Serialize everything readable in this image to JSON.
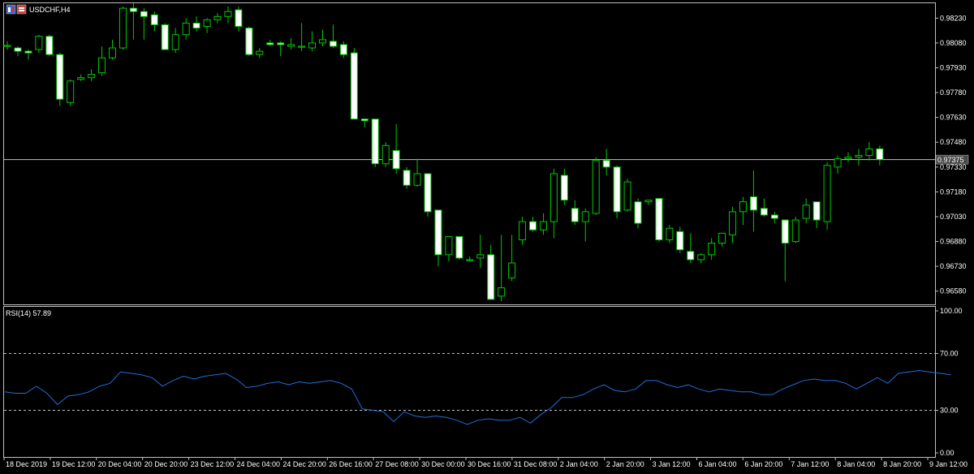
{
  "window": {
    "symbol_title": "USDCHF,H4"
  },
  "chart_data": [
    {
      "type": "candlestick",
      "title": "USDCHF,H4",
      "ylim": [
        0.965,
        0.9832
      ],
      "y_ticks": [
        "0.98230",
        "0.98080",
        "0.97930",
        "0.97780",
        "0.97630",
        "0.97480",
        "0.97330",
        "0.97180",
        "0.97030",
        "0.96880",
        "0.96730",
        "0.96580"
      ],
      "current_price_label": "0.97375",
      "current_price": 0.97375,
      "bull_color": "#00c800",
      "bear_color": "#ffffff",
      "x_labels": [
        "18 Dec 2019",
        "19 Dec 12:00",
        "20 Dec 04:00",
        "20 Dec 20:00",
        "23 Dec 12:00",
        "24 Dec 04:00",
        "24 Dec 20:00",
        "26 Dec 16:00",
        "27 Dec 08:00",
        "30 Dec 00:00",
        "30 Dec 16:00",
        "31 Dec 08:00",
        "2 Jan 04:00",
        "2 Jan 20:00",
        "3 Jan 12:00",
        "6 Jan 04:00",
        "6 Jan 20:00",
        "7 Jan 12:00",
        "8 Jan 04:00",
        "8 Jan 20:00",
        "9 Jan 12:00"
      ],
      "candles": [
        {
          "o": 0.9806,
          "h": 0.9809,
          "l": 0.9804,
          "c": 0.98065
        },
        {
          "o": 0.9805,
          "h": 0.9806,
          "l": 0.98,
          "c": 0.9803
        },
        {
          "o": 0.9803,
          "h": 0.9804,
          "l": 0.9798,
          "c": 0.9802
        },
        {
          "o": 0.9804,
          "h": 0.9813,
          "l": 0.9802,
          "c": 0.9812
        },
        {
          "o": 0.9812,
          "h": 0.9813,
          "l": 0.98,
          "c": 0.9801
        },
        {
          "o": 0.9801,
          "h": 0.9802,
          "l": 0.977,
          "c": 0.9774
        },
        {
          "o": 0.9772,
          "h": 0.9786,
          "l": 0.977,
          "c": 0.9785
        },
        {
          "o": 0.9786,
          "h": 0.9789,
          "l": 0.9785,
          "c": 0.9787
        },
        {
          "o": 0.9787,
          "h": 0.9792,
          "l": 0.9785,
          "c": 0.9789
        },
        {
          "o": 0.979,
          "h": 0.9806,
          "l": 0.9788,
          "c": 0.9799
        },
        {
          "o": 0.9799,
          "h": 0.981,
          "l": 0.9798,
          "c": 0.9805
        },
        {
          "o": 0.9805,
          "h": 0.983,
          "l": 0.9804,
          "c": 0.9829
        },
        {
          "o": 0.9829,
          "h": 0.9832,
          "l": 0.981,
          "c": 0.9827
        },
        {
          "o": 0.9827,
          "h": 0.9829,
          "l": 0.981,
          "c": 0.9824
        },
        {
          "o": 0.9825,
          "h": 0.9827,
          "l": 0.9815,
          "c": 0.9819
        },
        {
          "o": 0.9819,
          "h": 0.982,
          "l": 0.9804,
          "c": 0.9804
        },
        {
          "o": 0.9804,
          "h": 0.9817,
          "l": 0.9802,
          "c": 0.9813
        },
        {
          "o": 0.9813,
          "h": 0.9823,
          "l": 0.981,
          "c": 0.982
        },
        {
          "o": 0.982,
          "h": 0.9824,
          "l": 0.9815,
          "c": 0.9817
        },
        {
          "o": 0.9818,
          "h": 0.9823,
          "l": 0.9814,
          "c": 0.9822
        },
        {
          "o": 0.9822,
          "h": 0.9826,
          "l": 0.982,
          "c": 0.9824
        },
        {
          "o": 0.9824,
          "h": 0.983,
          "l": 0.982,
          "c": 0.9827
        },
        {
          "o": 0.9828,
          "h": 0.983,
          "l": 0.9815,
          "c": 0.9818
        },
        {
          "o": 0.9817,
          "h": 0.9818,
          "l": 0.98,
          "c": 0.9801
        },
        {
          "o": 0.9801,
          "h": 0.9805,
          "l": 0.9799,
          "c": 0.9803
        },
        {
          "o": 0.9808,
          "h": 0.981,
          "l": 0.9806,
          "c": 0.9807
        },
        {
          "o": 0.9808,
          "h": 0.9809,
          "l": 0.98,
          "c": 0.9807
        },
        {
          "o": 0.9806,
          "h": 0.9811,
          "l": 0.9804,
          "c": 0.9807
        },
        {
          "o": 0.9806,
          "h": 0.982,
          "l": 0.9803,
          "c": 0.9806
        },
        {
          "o": 0.9805,
          "h": 0.9815,
          "l": 0.9803,
          "c": 0.9808
        },
        {
          "o": 0.9808,
          "h": 0.9816,
          "l": 0.9806,
          "c": 0.981
        },
        {
          "o": 0.9809,
          "h": 0.9819,
          "l": 0.9805,
          "c": 0.9806
        },
        {
          "o": 0.9807,
          "h": 0.9809,
          "l": 0.9799,
          "c": 0.9801
        },
        {
          "o": 0.9802,
          "h": 0.9805,
          "l": 0.9762,
          "c": 0.9762
        },
        {
          "o": 0.9762,
          "h": 0.9762,
          "l": 0.9757,
          "c": 0.9761
        },
        {
          "o": 0.9762,
          "h": 0.9762,
          "l": 0.9733,
          "c": 0.9735
        },
        {
          "o": 0.9735,
          "h": 0.9748,
          "l": 0.9733,
          "c": 0.9746
        },
        {
          "o": 0.9743,
          "h": 0.9759,
          "l": 0.9729,
          "c": 0.9732
        },
        {
          "o": 0.9731,
          "h": 0.9733,
          "l": 0.972,
          "c": 0.9722
        },
        {
          "o": 0.9722,
          "h": 0.9738,
          "l": 0.9721,
          "c": 0.9729
        },
        {
          "o": 0.9729,
          "h": 0.9729,
          "l": 0.9703,
          "c": 0.9706
        },
        {
          "o": 0.9707,
          "h": 0.9707,
          "l": 0.9673,
          "c": 0.968
        },
        {
          "o": 0.968,
          "h": 0.969,
          "l": 0.9676,
          "c": 0.9691
        },
        {
          "o": 0.9691,
          "h": 0.9691,
          "l": 0.9677,
          "c": 0.9678
        },
        {
          "o": 0.9677,
          "h": 0.9679,
          "l": 0.9676,
          "c": 0.9677
        },
        {
          "o": 0.9678,
          "h": 0.9692,
          "l": 0.9672,
          "c": 0.968
        },
        {
          "o": 0.968,
          "h": 0.9686,
          "l": 0.9653,
          "c": 0.9653
        },
        {
          "o": 0.9655,
          "h": 0.9692,
          "l": 0.9652,
          "c": 0.966
        },
        {
          "o": 0.9666,
          "h": 0.9692,
          "l": 0.9664,
          "c": 0.9675
        },
        {
          "o": 0.9689,
          "h": 0.9703,
          "l": 0.9686,
          "c": 0.97
        },
        {
          "o": 0.97,
          "h": 0.9703,
          "l": 0.9694,
          "c": 0.9695
        },
        {
          "o": 0.9695,
          "h": 0.9705,
          "l": 0.9692,
          "c": 0.97
        },
        {
          "o": 0.97,
          "h": 0.9732,
          "l": 0.969,
          "c": 0.9729
        },
        {
          "o": 0.9728,
          "h": 0.9732,
          "l": 0.971,
          "c": 0.9713
        },
        {
          "o": 0.9708,
          "h": 0.9713,
          "l": 0.9698,
          "c": 0.97
        },
        {
          "o": 0.97,
          "h": 0.9708,
          "l": 0.9688,
          "c": 0.9706
        },
        {
          "o": 0.9705,
          "h": 0.9739,
          "l": 0.9704,
          "c": 0.9737
        },
        {
          "o": 0.9737,
          "h": 0.9744,
          "l": 0.9728,
          "c": 0.9733
        },
        {
          "o": 0.9733,
          "h": 0.9734,
          "l": 0.9702,
          "c": 0.9706
        },
        {
          "o": 0.9707,
          "h": 0.9726,
          "l": 0.9706,
          "c": 0.9724
        },
        {
          "o": 0.9712,
          "h": 0.9714,
          "l": 0.9696,
          "c": 0.9699
        },
        {
          "o": 0.9712,
          "h": 0.9713,
          "l": 0.971,
          "c": 0.9713
        },
        {
          "o": 0.9714,
          "h": 0.9714,
          "l": 0.9688,
          "c": 0.9689
        },
        {
          "o": 0.9689,
          "h": 0.9698,
          "l": 0.9687,
          "c": 0.9696
        },
        {
          "o": 0.9694,
          "h": 0.9697,
          "l": 0.9681,
          "c": 0.9683
        },
        {
          "o": 0.9682,
          "h": 0.9693,
          "l": 0.9675,
          "c": 0.9677
        },
        {
          "o": 0.9677,
          "h": 0.9681,
          "l": 0.9675,
          "c": 0.968
        },
        {
          "o": 0.968,
          "h": 0.969,
          "l": 0.9677,
          "c": 0.9687
        },
        {
          "o": 0.9687,
          "h": 0.9693,
          "l": 0.9685,
          "c": 0.9693
        },
        {
          "o": 0.9692,
          "h": 0.9709,
          "l": 0.9687,
          "c": 0.9706
        },
        {
          "o": 0.9706,
          "h": 0.9715,
          "l": 0.9698,
          "c": 0.9712
        },
        {
          "o": 0.9715,
          "h": 0.9731,
          "l": 0.9694,
          "c": 0.9707
        },
        {
          "o": 0.9708,
          "h": 0.9714,
          "l": 0.9703,
          "c": 0.9704
        },
        {
          "o": 0.9704,
          "h": 0.9706,
          "l": 0.9699,
          "c": 0.9702
        },
        {
          "o": 0.9701,
          "h": 0.9701,
          "l": 0.9664,
          "c": 0.9687
        },
        {
          "o": 0.9688,
          "h": 0.9703,
          "l": 0.9687,
          "c": 0.9701
        },
        {
          "o": 0.9702,
          "h": 0.9714,
          "l": 0.9699,
          "c": 0.971
        },
        {
          "o": 0.9712,
          "h": 0.9712,
          "l": 0.9696,
          "c": 0.9701
        },
        {
          "o": 0.97,
          "h": 0.9736,
          "l": 0.9695,
          "c": 0.9734
        },
        {
          "o": 0.9733,
          "h": 0.974,
          "l": 0.9729,
          "c": 0.9738
        },
        {
          "o": 0.9738,
          "h": 0.9742,
          "l": 0.9736,
          "c": 0.9739
        },
        {
          "o": 0.9739,
          "h": 0.9744,
          "l": 0.9734,
          "c": 0.974
        },
        {
          "o": 0.974,
          "h": 0.9748,
          "l": 0.9737,
          "c": 0.9744
        },
        {
          "o": 0.9744,
          "h": 0.9746,
          "l": 0.9734,
          "c": 0.97375
        }
      ]
    },
    {
      "type": "line",
      "title": "RSI(14) 57.89",
      "ylim": [
        0,
        100
      ],
      "y_ticks": [
        "100.00",
        "70.00",
        "30.00",
        "0.00"
      ],
      "levels": [
        70,
        30
      ],
      "line_color": "#1e6fd9",
      "values": [
        43,
        42,
        42,
        47,
        42,
        34,
        40,
        41,
        43,
        47,
        49,
        57,
        56,
        55,
        53,
        47,
        51,
        54,
        52,
        54,
        55,
        56,
        52,
        46,
        47,
        49,
        50,
        48,
        50,
        49,
        50,
        51,
        49,
        45,
        31,
        30,
        29,
        22,
        29,
        26,
        25,
        26,
        25,
        23,
        20,
        23,
        24,
        23,
        23,
        25,
        21,
        27,
        32,
        39,
        39,
        41,
        45,
        48,
        44,
        43,
        45,
        51,
        51,
        48,
        46,
        48,
        45,
        43,
        45,
        44,
        43,
        43,
        41,
        41,
        45,
        48,
        51,
        52,
        51,
        51,
        49,
        45,
        49,
        53,
        49,
        56,
        57,
        58,
        57,
        56,
        55
      ]
    }
  ]
}
